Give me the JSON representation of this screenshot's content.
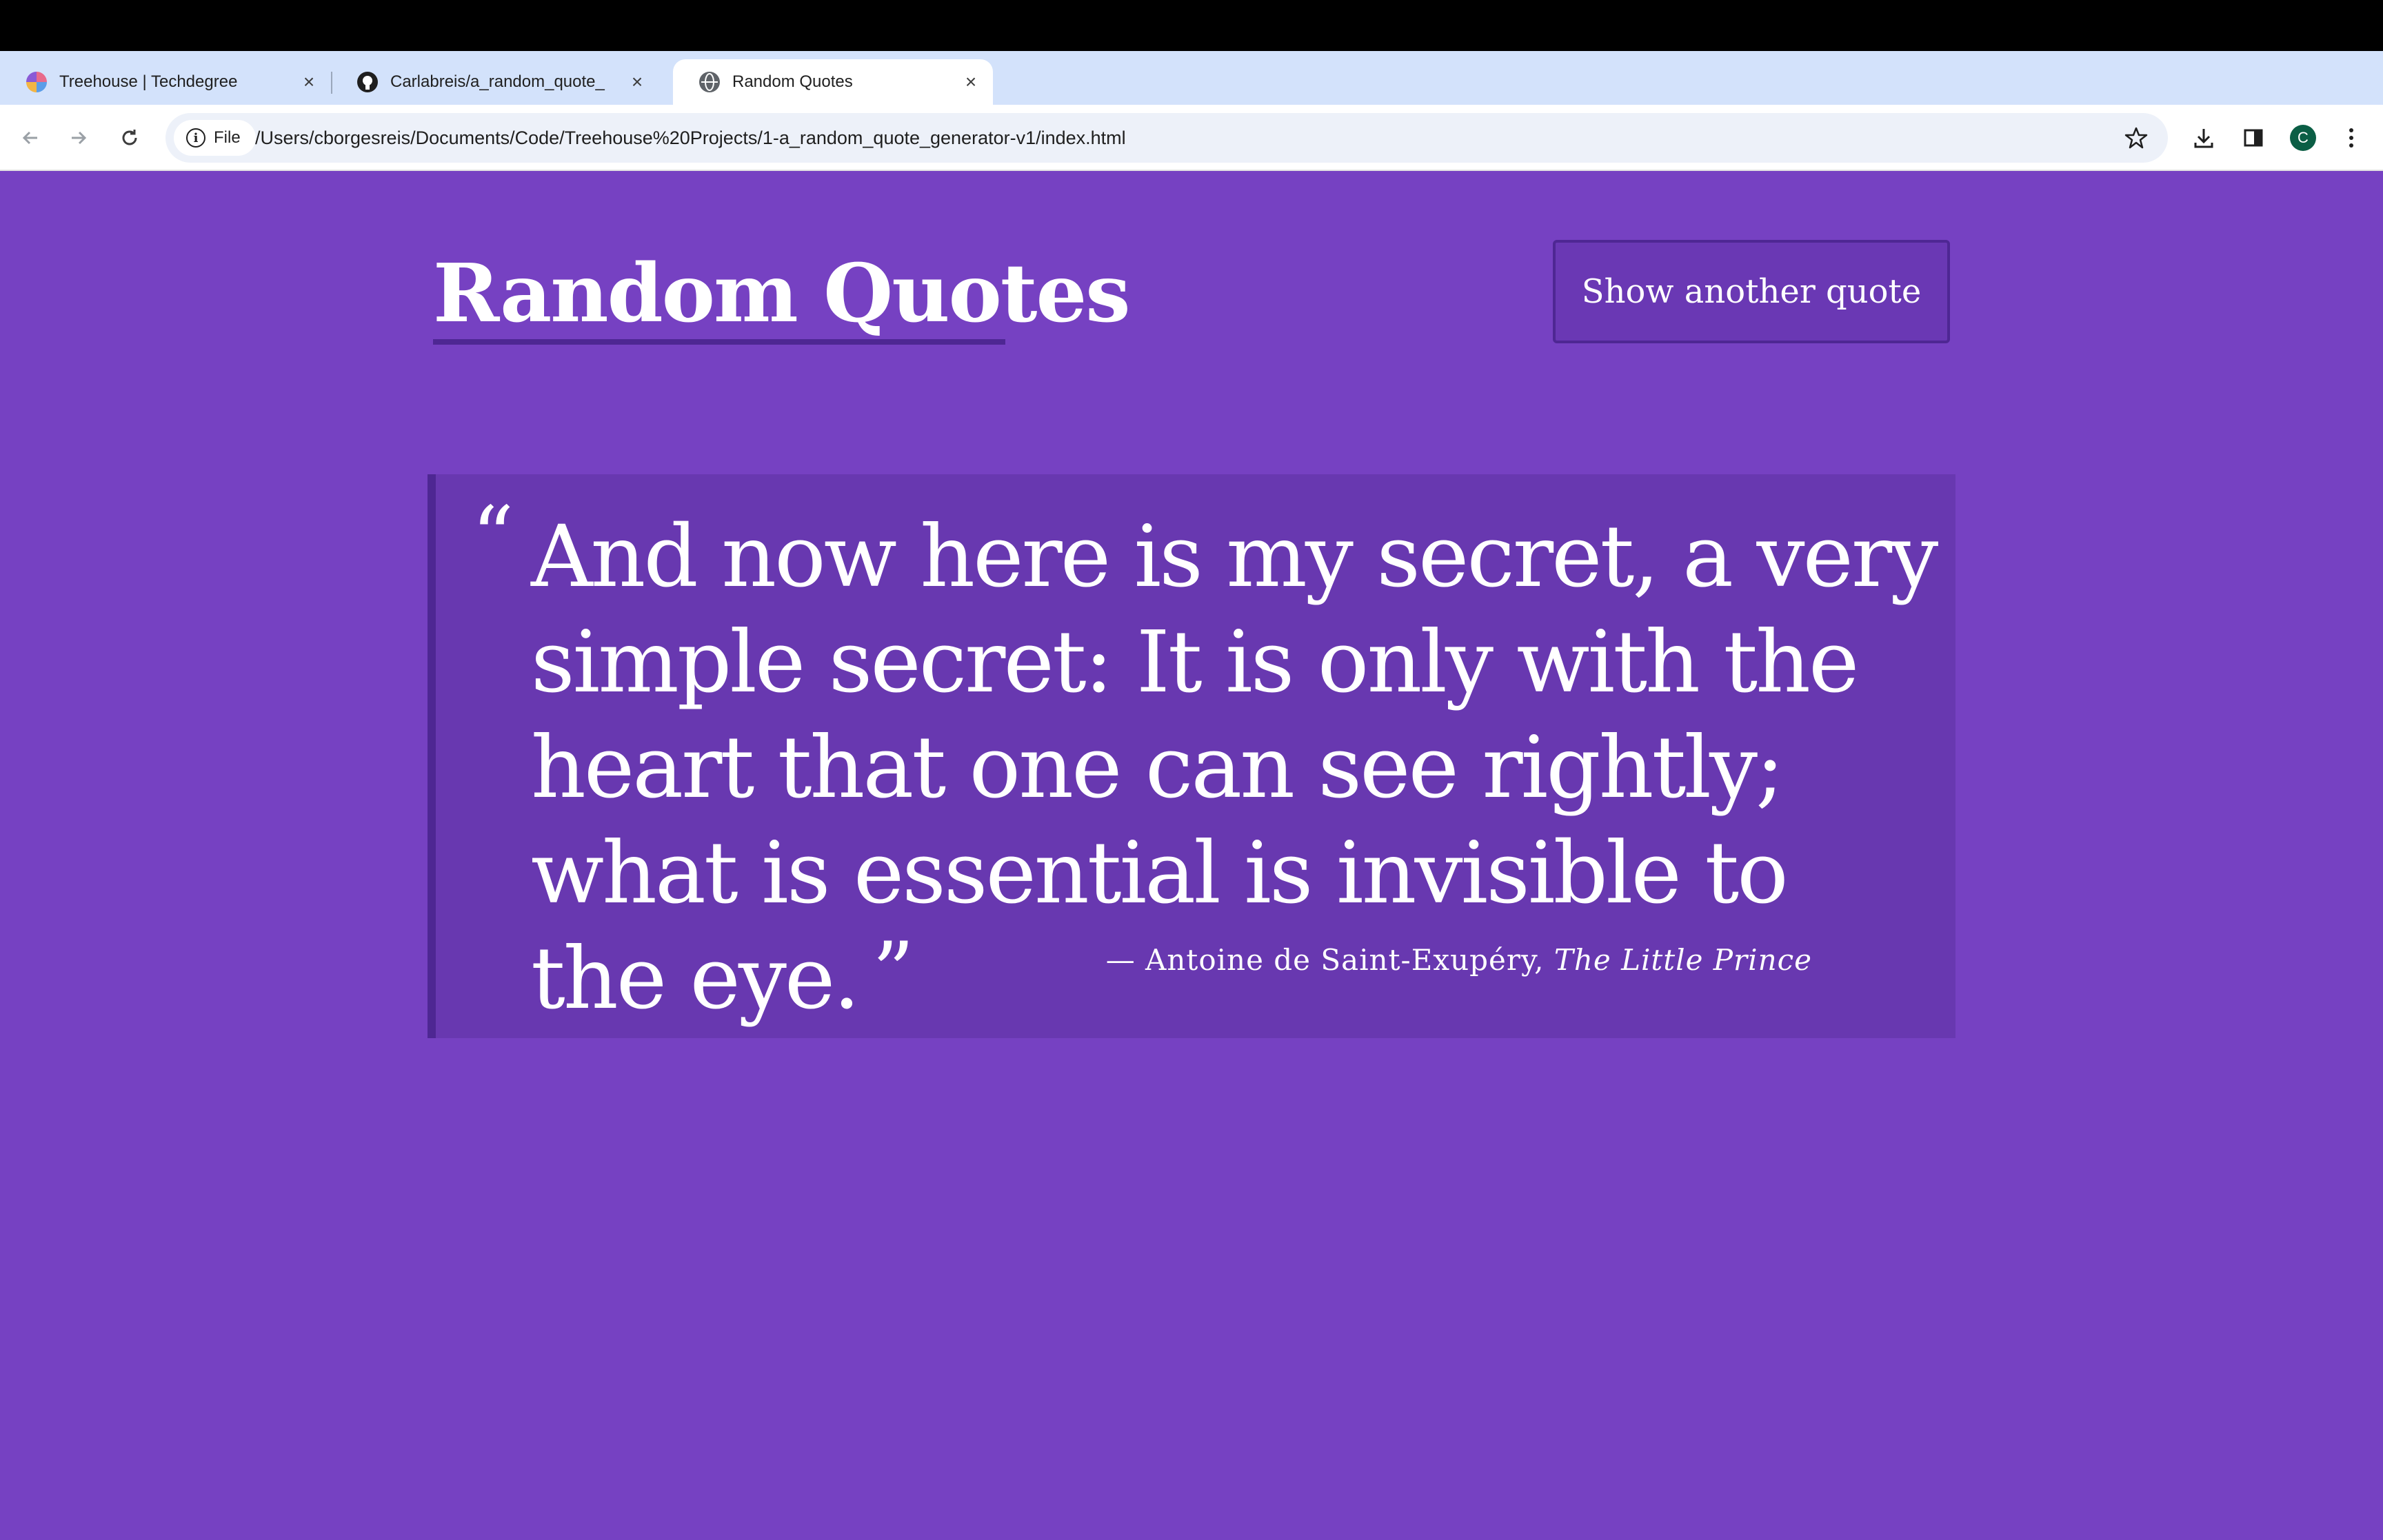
{
  "browser": {
    "tabs": [
      {
        "title": "Treehouse | Techdegree",
        "favicon": "treehouse-icon"
      },
      {
        "title": "Carlabreis/a_random_quote_",
        "favicon": "github-icon"
      },
      {
        "title": "Random Quotes",
        "favicon": "globe-icon",
        "active": true
      }
    ],
    "address": {
      "chip_label": "File",
      "url": "/Users/cborgesreis/Documents/Code/Treehouse%20Projects/1-a_random_quote_generator-v1/index.html"
    },
    "profile_initial": "C"
  },
  "page": {
    "title": "Random Quotes",
    "button_label": "Show another quote",
    "quote": {
      "open_mark": "“",
      "text": "And now here is my secret, a very simple secret: It is only with the heart that one can see rightly; what is essential is invisible to the eye.",
      "close_mark": "”",
      "source_prefix": "— Antoine de Saint-Exupéry, ",
      "citation": "The Little Prince"
    }
  },
  "colors": {
    "page_background": "#7641c2",
    "quote_background": "#6838b0",
    "accent_dark": "#4e2793",
    "text": "#ffffff"
  }
}
